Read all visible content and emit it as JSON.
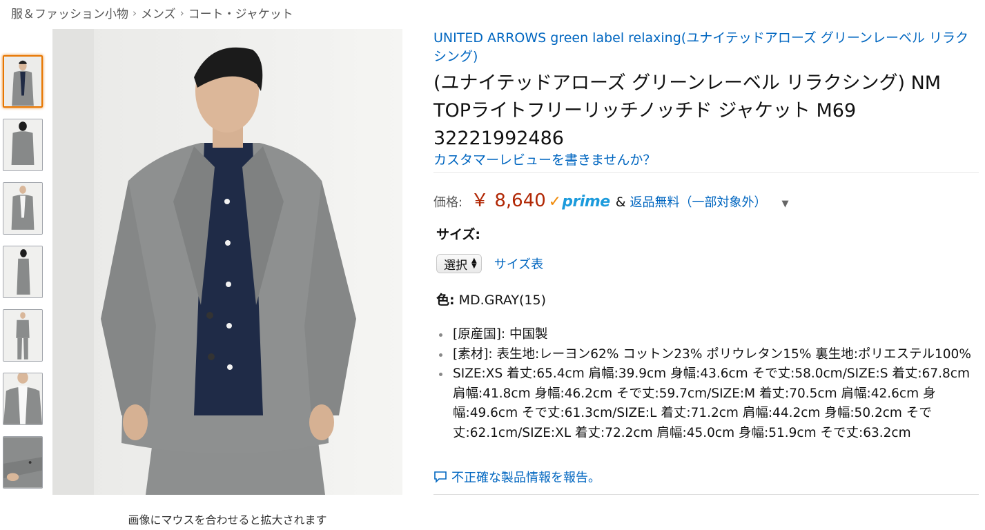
{
  "breadcrumb": [
    "服＆ファッション小物",
    "メンズ",
    "コート・ジャケット"
  ],
  "breadcrumb_separator": "›",
  "gallery": {
    "thumbnails": [
      {
        "name": "thumb-front-full",
        "selected": true
      },
      {
        "name": "thumb-back"
      },
      {
        "name": "thumb-open-front"
      },
      {
        "name": "thumb-side"
      },
      {
        "name": "thumb-full-body"
      },
      {
        "name": "thumb-collar-detail"
      },
      {
        "name": "thumb-sleeve-detail"
      }
    ],
    "zoom_hint": "画像にマウスを合わせると拡大されます"
  },
  "product": {
    "brand": "UNITED ARROWS green label relaxing(ユナイテッドアローズ グリーンレーベル リラクシング)",
    "title": "(ユナイテッドアローズ グリーンレーベル リラクシング) NM TOPライトフリーリッチノッチド ジャケット M69 32221992486",
    "review_link": "カスタマーレビューを書きませんか？",
    "price_label": "価格:",
    "price": "￥ 8,640",
    "prime_check": "✓",
    "prime_word": "prime",
    "amp": "&",
    "free_returns": "返品無料（一部対象外）",
    "size_label": "サイズ:",
    "size_select": "選択",
    "size_chart": "サイズ表",
    "color_label": "色:",
    "color_value": "MD.GRAY(15)",
    "bullets": [
      "[原産国]: 中国製",
      "[素材]: 表生地:レーヨン62% コットン23% ポリウレタン15% 裏生地:ポリエステル100%",
      "SIZE:XS 着丈:65.4cm 肩幅:39.9cm 身幅:43.6cm そで丈:58.0cm/SIZE:S 着丈:67.8cm 肩幅:41.8cm 身幅:46.2cm そで丈:59.7cm/SIZE:M 着丈:70.5cm 肩幅:42.6cm 身幅:49.6cm そで丈:61.3cm/SIZE:L 着丈:71.2cm 肩幅:44.2cm 身幅:50.2cm そで丈:62.1cm/SIZE:XL 着丈:72.2cm 肩幅:45.0cm 身幅:51.9cm そで丈:63.2cm"
    ],
    "report_link": "不正確な製品情報を報告。"
  },
  "colors": {
    "link": "#0066c0",
    "price": "#b12704",
    "prime_check": "#f08804",
    "prime_word": "#1c9bdc",
    "thumb_selected_border": "#e77600"
  }
}
